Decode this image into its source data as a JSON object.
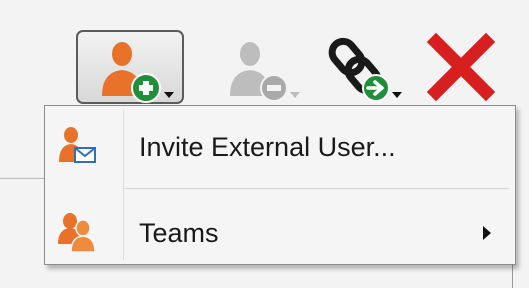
{
  "toolbar": {
    "buttons": [
      {
        "name": "add-user",
        "icon": "add-user-icon",
        "state": "pressed"
      },
      {
        "name": "remove-user",
        "icon": "remove-user-icon",
        "state": "disabled"
      },
      {
        "name": "link-user",
        "icon": "link-user-icon",
        "state": "enabled"
      },
      {
        "name": "delete",
        "icon": "close-icon",
        "state": "enabled"
      }
    ],
    "colors": {
      "user_orange": "#e8722a",
      "add_green": "#1f8f3a",
      "delete_red": "#d81f1f",
      "disabled_gray": "#b8b8b8"
    }
  },
  "menu": {
    "items": [
      {
        "label": "Invite External User...",
        "icon": "invite-user-email-icon"
      },
      {
        "label": "Teams",
        "icon": "teams-icon",
        "has_submenu": true
      }
    ]
  }
}
